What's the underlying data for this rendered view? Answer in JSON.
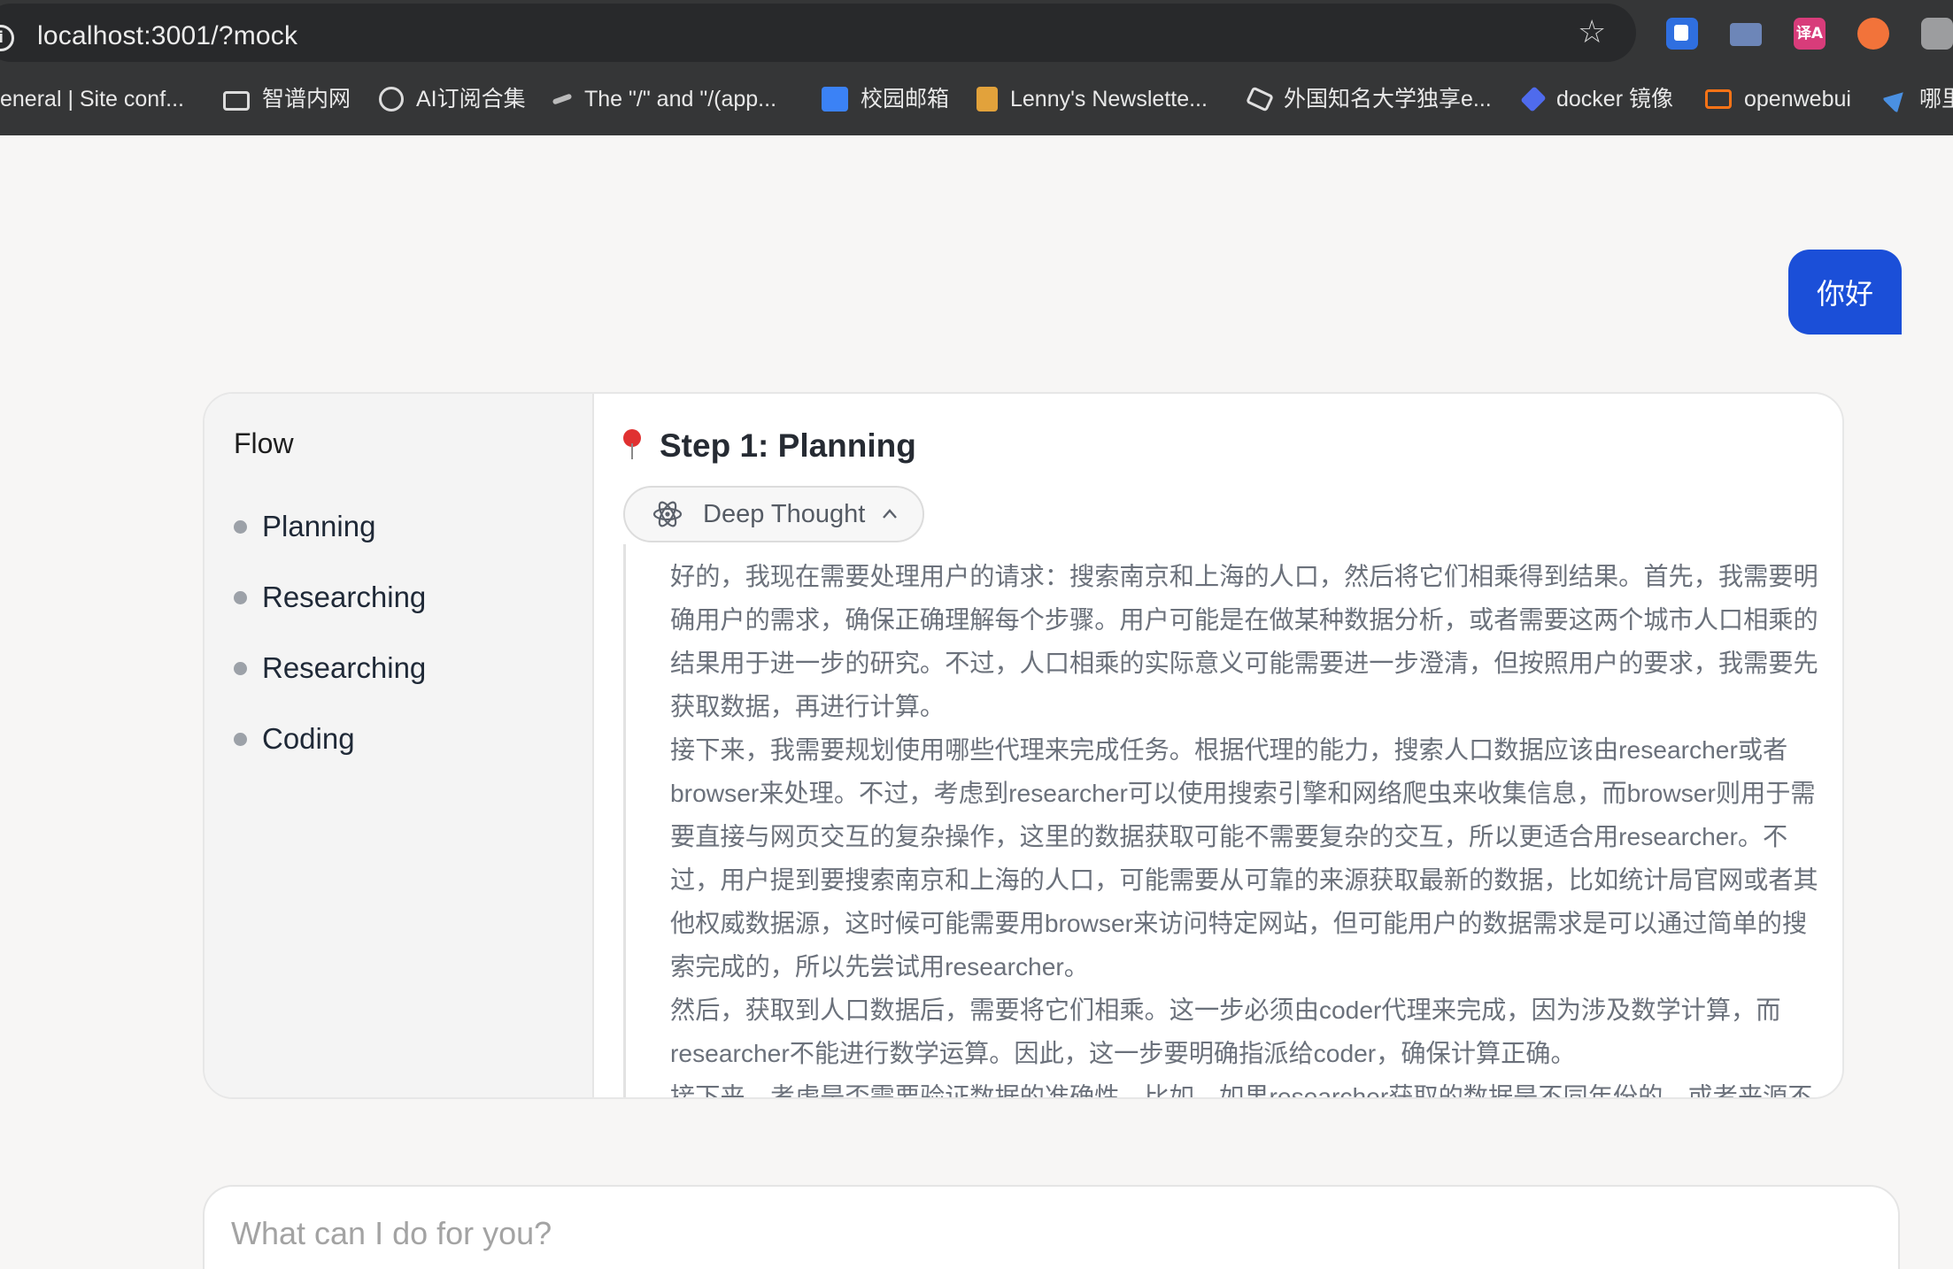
{
  "browser": {
    "url": "localhost:3001/?mock",
    "extensions": [
      "bookmark-lock-icon",
      "toolbox-icon",
      "translate-icon",
      "rss-icon",
      "camera-icon"
    ],
    "ext_translate_label": "译A",
    "bookmarks": [
      {
        "label": "eneral | Site conf...",
        "icon": "site-icon"
      },
      {
        "label": "智谱内网",
        "icon": "folder-icon"
      },
      {
        "label": "AI订阅合集",
        "icon": "globe-icon"
      },
      {
        "label": "The \"/\" and \"/(app...",
        "icon": "arrow-icon"
      },
      {
        "label": "校园邮箱",
        "icon": "graduation-cap-icon"
      },
      {
        "label": "Lenny's Newslette...",
        "icon": "newsletter-icon"
      },
      {
        "label": "外国知名大学独享e...",
        "icon": "plane-icon"
      },
      {
        "label": "docker 镜像",
        "icon": "docker-icon"
      },
      {
        "label": "openwebui",
        "icon": "openwebui-icon"
      },
      {
        "label": "哪里",
        "icon": "send-icon"
      }
    ]
  },
  "chat": {
    "user_message": "你好"
  },
  "flow": {
    "title": "Flow",
    "steps": [
      "Planning",
      "Researching",
      "Researching",
      "Coding"
    ],
    "current_step_title": "Step 1: Planning",
    "deep_thought_label": "Deep Thought",
    "thought_paragraphs": [
      "好的，我现在需要处理用户的请求：搜索南京和上海的人口，然后将它们相乘得到结果。首先，我需要明确用户的需求，确保正确理解每个步骤。用户可能是在做某种数据分析，或者需要这两个城市人口相乘的结果用于进一步的研究。不过，人口相乘的实际意义可能需要进一步澄清，但按照用户的要求，我需要先获取数据，再进行计算。",
      "接下来，我需要规划使用哪些代理来完成任务。根据代理的能力，搜索人口数据应该由researcher或者browser来处理。不过，考虑到researcher可以使用搜索引擎和网络爬虫来收集信息，而browser则用于需要直接与网页交互的复杂操作，这里的数据获取可能不需要复杂的交互，所以更适合用researcher。不过，用户提到要搜索南京和上海的人口，可能需要从可靠的来源获取最新的数据，比如统计局官网或者其他权威数据源，这时候可能需要用browser来访问特定网站，但可能用户的数据需求是可以通过简单的搜索完成的，所以先尝试用researcher。",
      "然后，获取到人口数据后，需要将它们相乘。这一步必须由coder代理来完成，因为涉及数学计算，而researcher不能进行数学运算。因此，这一步要明确指派给coder，确保计算正确。",
      "接下来，考虑是否需要验证数据的准确性。比如，如果researcher获取的数据是不同年份的，或者来源不"
    ]
  },
  "input": {
    "placeholder": "What can I do for you?"
  }
}
